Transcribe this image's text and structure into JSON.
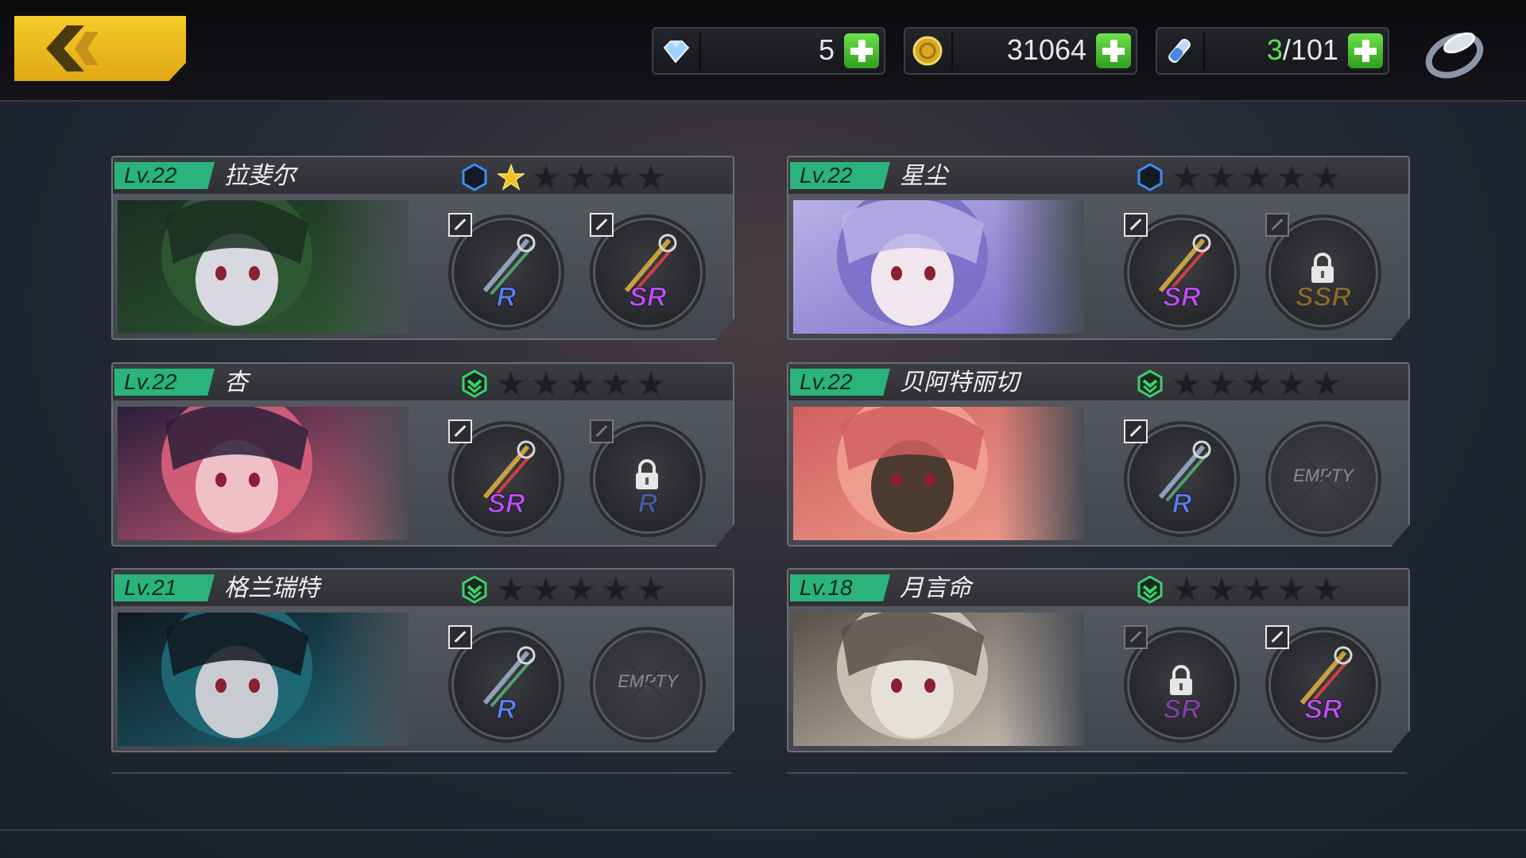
{
  "topbar": {
    "back_icon": "back-arrow-icon",
    "resources": [
      {
        "icon": "crystal-icon",
        "value": "5"
      },
      {
        "icon": "gold-coin-icon",
        "value": "31064"
      },
      {
        "icon": "stamina-vial-icon",
        "value_current": "3",
        "value_rest": "/101"
      }
    ],
    "ring_icon": "ring-icon"
  },
  "characters": [
    {
      "level": "Lv.22",
      "name": "拉斐尔",
      "rank_icon": "blue-hexagon-icon",
      "stars_filled": 1,
      "stars_total": 5,
      "slots": [
        {
          "rarity": "R",
          "locked": false
        },
        {
          "rarity": "SR",
          "locked": false
        }
      ]
    },
    {
      "level": "Lv.22",
      "name": "星尘",
      "rank_icon": "blue-hexagon-icon",
      "stars_filled": 0,
      "stars_total": 5,
      "slots": [
        {
          "rarity": "SR",
          "locked": false
        },
        {
          "rarity": "SSR",
          "locked": true
        }
      ]
    },
    {
      "level": "Lv.22",
      "name": "杏",
      "rank_icon": "green-chevron-icon",
      "stars_filled": 0,
      "stars_total": 5,
      "slots": [
        {
          "rarity": "SR",
          "locked": false
        },
        {
          "rarity": "R",
          "locked": true
        }
      ]
    },
    {
      "level": "Lv.22",
      "name": "贝阿特丽切",
      "rank_icon": "green-chevron-icon",
      "stars_filled": 0,
      "stars_total": 5,
      "slots": [
        {
          "rarity": "R",
          "locked": false
        },
        {
          "empty": true,
          "label": "EMPTY"
        }
      ]
    },
    {
      "level": "Lv.21",
      "name": "格兰瑞特",
      "rank_icon": "green-chevron-icon",
      "stars_filled": 0,
      "stars_total": 5,
      "slots": [
        {
          "rarity": "R",
          "locked": false
        },
        {
          "empty": true,
          "label": "EMPTY"
        }
      ]
    },
    {
      "level": "Lv.18",
      "name": "月言命",
      "rank_icon": "green-chevron-icon",
      "stars_filled": 0,
      "stars_total": 5,
      "slots": [
        {
          "rarity": "SR",
          "locked": true
        },
        {
          "rarity": "SR",
          "locked": false
        }
      ]
    }
  ],
  "colors": {
    "level_badge": "#2bb37c",
    "accent_yellow": "#f0c020",
    "rarity_r": "#5b7cff",
    "rarity_sr": "#c04dff",
    "rarity_ssr": "#d89a20"
  }
}
